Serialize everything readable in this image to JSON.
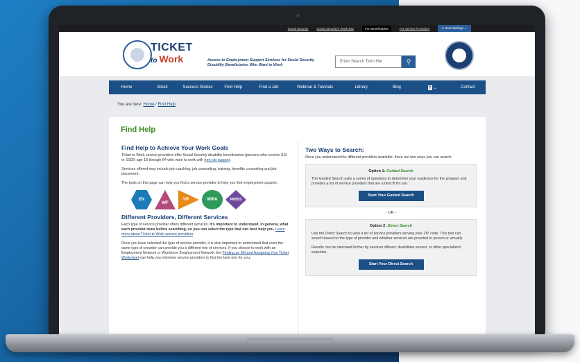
{
  "util_bar": {
    "links": [
      "Social Security",
      "Social Security's Work Site",
      "For Beneficiaries",
      "For Service Providers"
    ],
    "active_index": 2,
    "user_settings": "User Settings"
  },
  "header": {
    "logo_ticket": "TICKET",
    "logo_to": "to",
    "logo_work": "Work",
    "tagline": "Access to Employment Support Services for Social Security Disability Beneficiaries Who Want to Work",
    "search_placeholder": "Enter Search Term Her"
  },
  "nav": {
    "items": [
      "Home",
      "About",
      "Success Stories",
      "Find Help",
      "Find a Job",
      "Webinar & Tutorials",
      "Library",
      "Blog",
      "Contact"
    ],
    "social": "f"
  },
  "breadcrumb": {
    "prefix": "You are here:",
    "home": "Home",
    "sep": "/",
    "current": "Find Help"
  },
  "page": {
    "title": "Find Help",
    "left": {
      "heading": "Find Help to Achieve Your Work Goals",
      "p1": "Ticket to Work service providers offer Social Security disability beneficiaries (persons who receive SSI or SSDI) age 18 through 64 who want to work with",
      "p1_link": "free job support",
      "p2": "Services offered may include job coaching, job counseling, training, benefits counseling and job placement.",
      "p3": "The tools on this page can help you find a service provider to help you find employment support.",
      "badges": [
        "EN",
        "WF",
        "VR",
        "WIPA",
        "PABSS"
      ],
      "heading2": "Different Providers, Different Services",
      "p4a": "Each type of service provider offers different services.",
      "p4b": "It's important to understand, in general, what each provider does before searching, so you can select the type that can best help you.",
      "p4_link": "Learn more about Ticket to Work service providers",
      "p5a": "Once you have selected the type of service provider, it is also important to understand that even the same type of provider can provide you a different mix of services. If you choose to work with an Employment Network or Workforce Employment Network, the",
      "p5_link": "Finding an EN and Assigning Your Ticket Worksheet",
      "p5b": "can help you interview service providers to find the best one for you."
    },
    "right": {
      "heading": "Two Ways to Search:",
      "intro": "Once you understand the different providers available, there are two ways you can search.",
      "option1_label": "Option 1:",
      "option1_name": "Guided Search",
      "option1_text": "The Guided Search asks a series of questions to determine your readiness for the program and provides a list of service providers that are a best fit for you.",
      "option1_button": "Start Your Guided Search",
      "or_text": "- OR -",
      "option2_label": "Option 2:",
      "option2_name": "Direct Search",
      "option2_text": "Use the Direct Search to view a list of service providers serving your ZIP code. This tool can search based on the type of provider and whether services are provided in person or virtually.",
      "option2_text2": "Results can be narrowed further by services offered, disabilities served, or other specialized expertise.",
      "option2_button": "Start Your Direct Search"
    }
  }
}
